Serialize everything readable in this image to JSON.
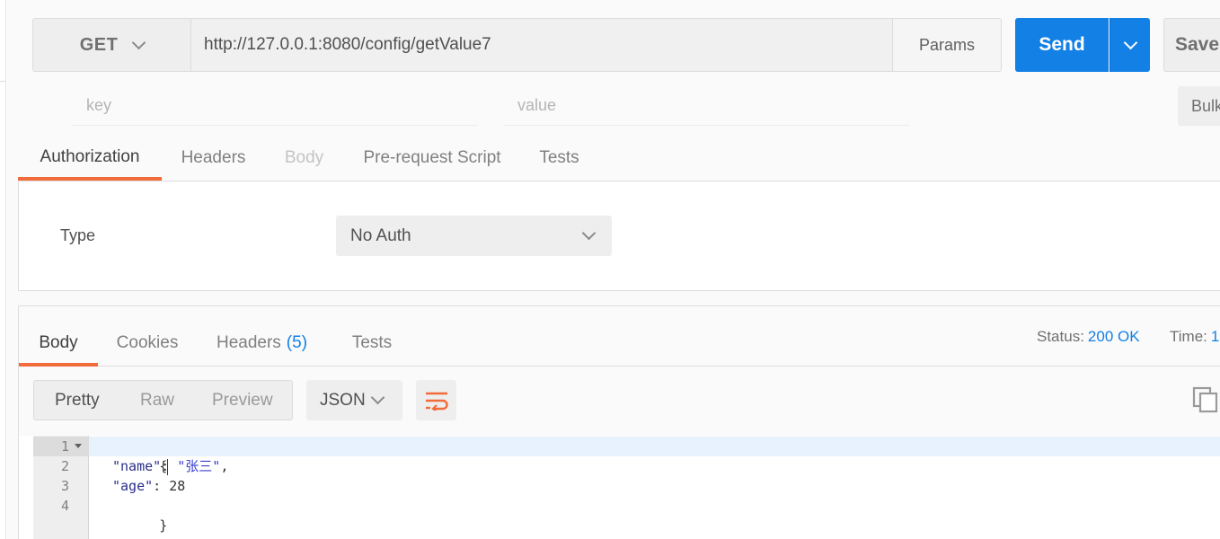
{
  "request": {
    "method": "GET",
    "url": "http://127.0.0.1:8080/config/getValue7",
    "params_label": "Params",
    "send_label": "Send",
    "save_label": "Save"
  },
  "params_row": {
    "key_placeholder": "key",
    "value_placeholder": "value",
    "bulk_label": "Bulk"
  },
  "request_tabs": {
    "authorization": "Authorization",
    "headers": "Headers",
    "body": "Body",
    "prerequest": "Pre-request Script",
    "tests": "Tests"
  },
  "auth": {
    "type_label": "Type",
    "type_value": "No Auth"
  },
  "response_tabs": {
    "body": "Body",
    "cookies": "Cookies",
    "headers": "Headers",
    "headers_count": "(5)",
    "tests": "Tests"
  },
  "response_meta": {
    "status_label": "Status:",
    "status_value": "200 OK",
    "time_label": "Time:",
    "time_value": "1"
  },
  "view_modes": {
    "pretty": "Pretty",
    "raw": "Raw",
    "preview": "Preview",
    "format": "JSON"
  },
  "editor": {
    "line_numbers": [
      "1",
      "2",
      "3",
      "4"
    ],
    "open_brace": "{",
    "close_brace": "}",
    "name_key": "\"name\"",
    "name_value": "\"张三\"",
    "age_key": "\"age\"",
    "age_value": "28"
  },
  "colors": {
    "accent": "#1380e6",
    "tab_underline": "#f26b3a"
  },
  "icons": {
    "method_dropdown": "chevron-down-icon",
    "send_dropdown": "chevron-down-icon",
    "wrap": "wrap-lines-icon",
    "copy": "copy-icon"
  }
}
